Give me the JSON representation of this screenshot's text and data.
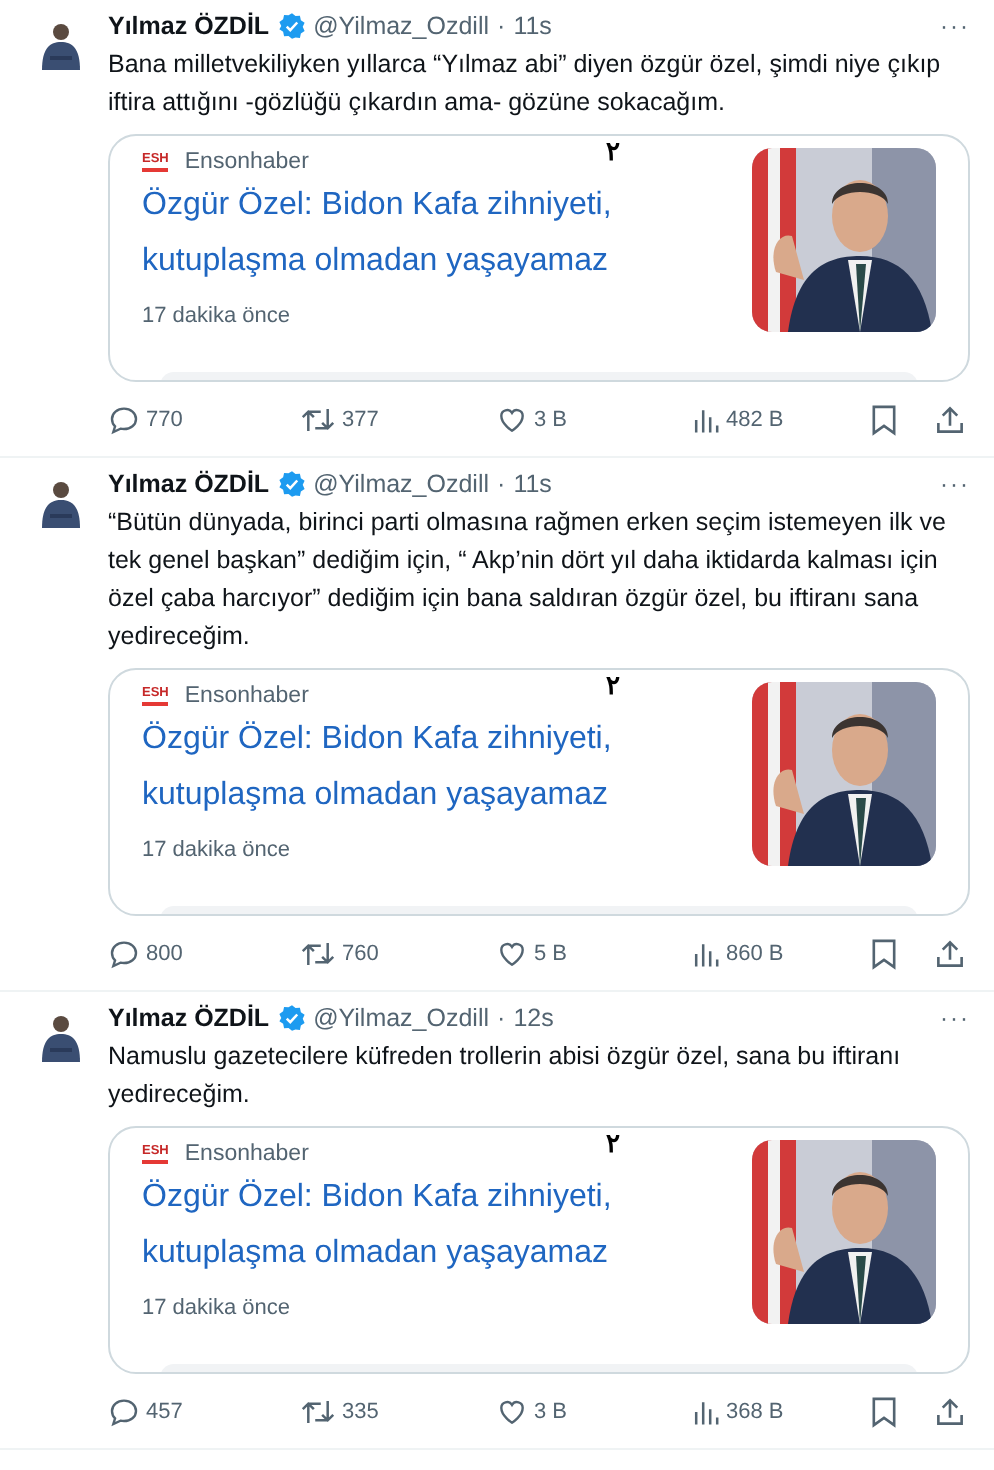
{
  "tweets": [
    {
      "author": "Yılmaz ÖZDİL",
      "verified": true,
      "handle": "@Yilmaz_Ozdill",
      "sep": "·",
      "time": "11s",
      "more": "···",
      "text": "Bana milletvekiliyken yıllarca “Yılmaz abi” diyen özgür özel, şimdi niye çıkıp iftira attığını -gözlüğü çıkardın ama- gözüne sokacağım.",
      "card": {
        "logo": "ESH",
        "source": "Ensonhaber",
        "mark": "۲",
        "title": "Özgür Özel: Bidon Kafa zihniyeti, kutuplaşma olmadan yaşayamaz",
        "age": "17 dakika önce"
      },
      "replies": "770",
      "reposts": "377",
      "likes": "3 B",
      "views": "482 B"
    },
    {
      "author": "Yılmaz ÖZDİL",
      "verified": true,
      "handle": "@Yilmaz_Ozdill",
      "sep": "·",
      "time": "11s",
      "more": "···",
      "text": "“Bütün dünyada, birinci parti olmasına rağmen erken seçim istemeyen ilk ve tek genel başkan” dediğim için, “ Akp’nin dört yıl daha iktidarda kalması için özel çaba harcıyor” dediğim için bana saldıran özgür özel, bu iftiranı sana yedireceğim.",
      "card": {
        "logo": "ESH",
        "source": "Ensonhaber",
        "mark": "۲",
        "title": "Özgür Özel: Bidon Kafa zihniyeti, kutuplaşma olmadan yaşayamaz",
        "age": "17 dakika önce"
      },
      "replies": "800",
      "reposts": "760",
      "likes": "5 B",
      "views": "860 B"
    },
    {
      "author": "Yılmaz ÖZDİL",
      "verified": true,
      "handle": "@Yilmaz_Ozdill",
      "sep": "·",
      "time": "12s",
      "more": "···",
      "text": "Namuslu gazetecilere küfreden trollerin abisi özgür özel, sana bu iftiranı yedireceğim.",
      "card": {
        "logo": "ESH",
        "source": "Ensonhaber",
        "mark": "۲",
        "title": "Özgür Özel: Bidon Kafa zihniyeti, kutuplaşma olmadan yaşayamaz",
        "age": "17 dakika önce"
      },
      "replies": "457",
      "reposts": "335",
      "likes": "3 B",
      "views": "368 B"
    }
  ]
}
